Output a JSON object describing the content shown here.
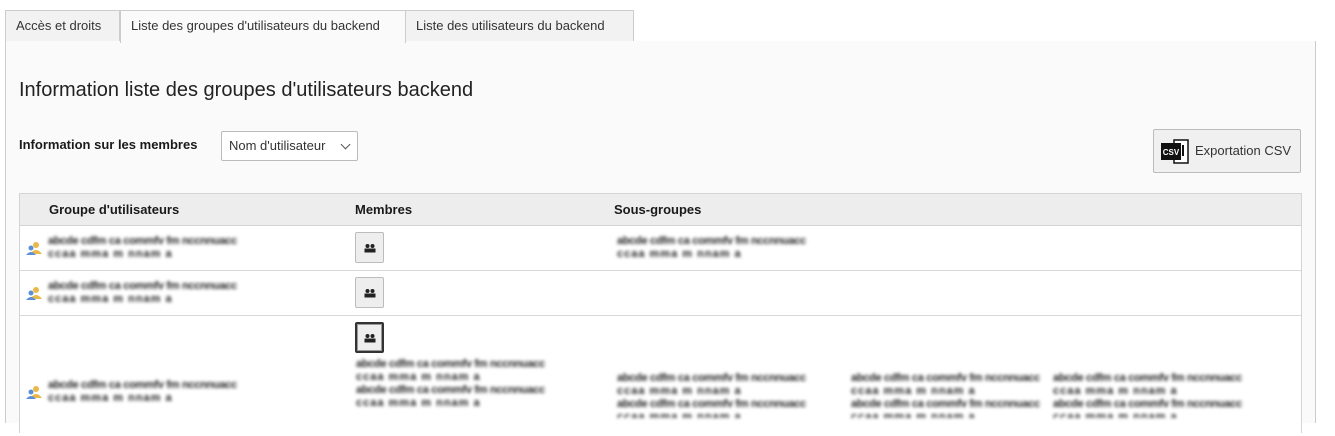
{
  "tabs": [
    {
      "label": "Accès et droits",
      "active": false
    },
    {
      "label": "Liste des groupes d'utilisateurs du backend",
      "active": true
    },
    {
      "label": "Liste des utilisateurs du backend",
      "active": false
    }
  ],
  "page": {
    "title": "Information liste des groupes d'utilisateurs backend",
    "member_info_label": "Information sur les membres",
    "member_select_value": "Nom d'utilisateur",
    "export_button": {
      "label": "Exportation CSV",
      "icon": "csv-file-icon",
      "icon_text": "CSV"
    }
  },
  "table": {
    "headers": [
      "Groupe d'utilisateurs",
      "Membres",
      "Sous-groupes"
    ],
    "redacted_text": {
      "line1": "abcde cdfm ca commfv fm nccnnuacc",
      "line2": "ccaa mma m nnam a"
    }
  },
  "colors": {
    "tab_border": "#cccccc",
    "panel_bg": "#fafafa",
    "header_bg": "#ededed",
    "group_icon": "#e8b84a",
    "group_icon_person": "#5b8fd6"
  }
}
